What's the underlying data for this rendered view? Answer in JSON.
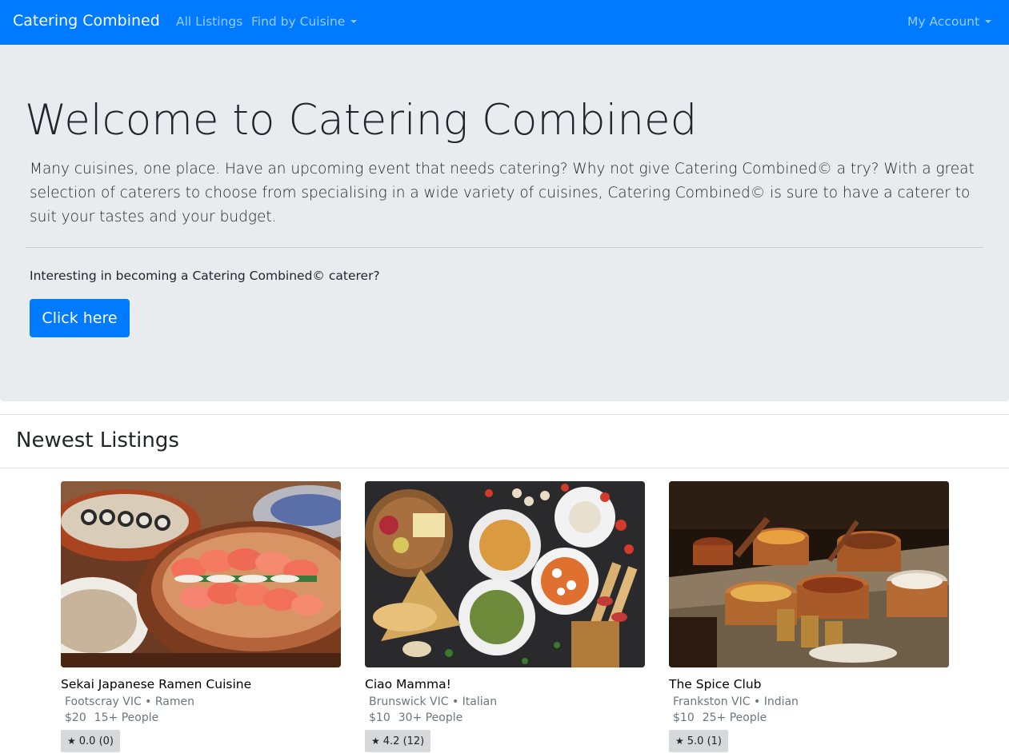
{
  "navbar": {
    "brand": "Catering Combined",
    "links": [
      "All Listings",
      "Find by Cuisine"
    ],
    "account": "My Account"
  },
  "hero": {
    "title": "Welcome to Catering Combined",
    "lead": "Many cuisines, one place. Have an upcoming event that needs catering? Why not give Catering Combined© a try? With a great selection of caterers to choose from specialising in a wide variety of cuisines, Catering Combined© is sure to have a caterer to suit your tastes and your budget.",
    "question": "Interesting in becoming a Catering Combined© caterer?",
    "button": "Click here"
  },
  "section": {
    "title": "Newest Listings"
  },
  "listings": [
    {
      "name": "Sekai Japanese Ramen Cuisine",
      "location": "Footscray VIC",
      "cuisine": "Ramen",
      "price": "$20",
      "people": "15+ People",
      "rating": "0.0 (0)"
    },
    {
      "name": "Ciao Mamma!",
      "location": "Brunswick VIC",
      "cuisine": "Italian",
      "price": "$10",
      "people": "30+ People",
      "rating": "4.2 (12)"
    },
    {
      "name": "The Spice Club",
      "location": "Frankston VIC",
      "cuisine": "Indian",
      "price": "$10",
      "people": "25+ People",
      "rating": "5.0 (1)"
    }
  ],
  "meta_separator": "•",
  "star_glyph": "★",
  "colors": {
    "primary": "#007bff",
    "jumbotron": "#e9ecef",
    "badge": "#d6d8db"
  }
}
